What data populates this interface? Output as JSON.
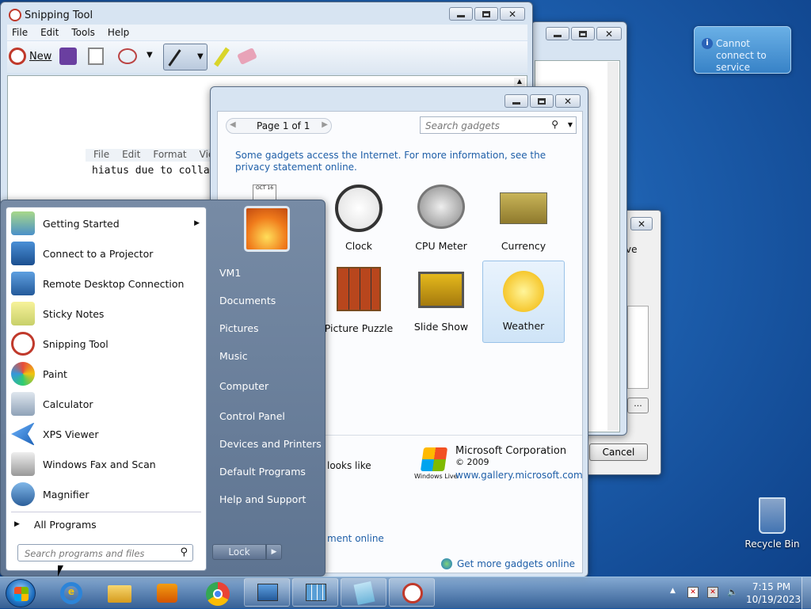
{
  "snipping": {
    "title": "Snipping Tool",
    "menu": [
      "File",
      "Edit",
      "Tools",
      "Help"
    ],
    "new_label": "New",
    "embedded_menu": [
      "File",
      "Edit",
      "Format",
      "View"
    ],
    "embedded_text": "hiatus due to colla"
  },
  "notification": {
    "text": "Cannot connect to service"
  },
  "gadgets": {
    "page_label": "Page 1 of 1",
    "search_placeholder": "Search gadgets",
    "notice": "Some gadgets access the Internet.  For more information, see the privacy statement online.",
    "items": [
      "Clock",
      "CPU Meter",
      "Currency",
      "Picture Puzzle",
      "Slide Show",
      "Weather"
    ],
    "desc_fragment": "looks like",
    "link_fragment": "ment online",
    "publisher": "Microsoft Corporation",
    "copyright": "© 2009",
    "url": "www.gallery.microsoft.com",
    "windows_live": "Windows Live",
    "get_more": "Get more gadgets online"
  },
  "dialog": {
    "cancel_label": "Cancel",
    "fragment": "ve",
    "dots": "..."
  },
  "start_menu": {
    "programs": [
      "Getting Started",
      "Connect to a Projector",
      "Remote Desktop Connection",
      "Sticky Notes",
      "Snipping Tool",
      "Paint",
      "Calculator",
      "XPS Viewer",
      "Windows Fax and Scan",
      "Magnifier"
    ],
    "all_programs": "All Programs",
    "search_placeholder": "Search programs and files",
    "right_links": [
      "VM1",
      "Documents",
      "Pictures",
      "Music",
      "Computer",
      "Control Panel",
      "Devices and Printers",
      "Default Programs",
      "Help and Support"
    ],
    "lock_label": "Lock"
  },
  "desktop": {
    "recycle_bin": "Recycle Bin"
  },
  "taskbar": {
    "time": "7:15 PM",
    "date": "10/19/2023"
  }
}
